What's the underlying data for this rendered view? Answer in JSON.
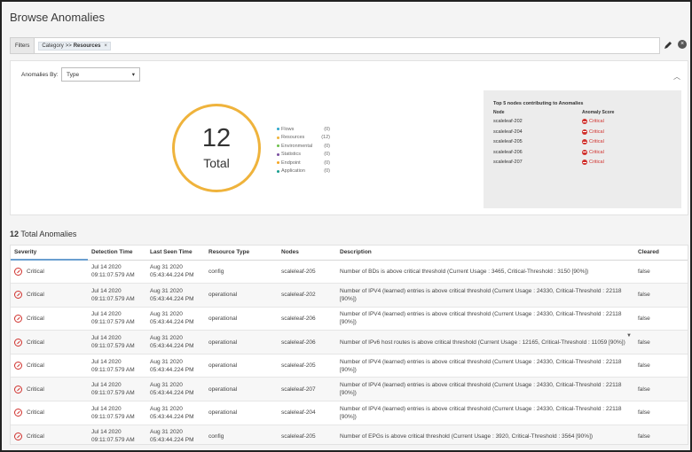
{
  "page": {
    "title": "Browse Anomalies"
  },
  "filters": {
    "label": "Filters",
    "chip_key": "Category",
    "chip_op": ">>",
    "chip_value": "Resources",
    "chip_remove": "×"
  },
  "summary": {
    "anomalies_by_label": "Anomalies By:",
    "anomalies_by_value": "Type",
    "total_count": "12",
    "total_label": "Total",
    "legend": [
      {
        "name": "Flows",
        "count": "(0)",
        "color": "#2ba6cb"
      },
      {
        "name": "Resources",
        "count": "(12)",
        "color": "#efb33c"
      },
      {
        "name": "Environmental",
        "count": "(0)",
        "color": "#6cc04a"
      },
      {
        "name": "Statistics",
        "count": "(0)",
        "color": "#7b4fa0"
      },
      {
        "name": "Endpoint",
        "count": "(0)",
        "color": "#f5a623"
      },
      {
        "name": "Application",
        "count": "(0)",
        "color": "#1a9e8f"
      }
    ],
    "ring_color": "#efb33c"
  },
  "top_nodes": {
    "title": "Top 5 nodes contributing to Anomalies",
    "col_node": "Node",
    "col_score": "Anomaly Score",
    "rows": [
      {
        "node": "scaleleaf-202",
        "score": "Critical"
      },
      {
        "node": "scaleleaf-204",
        "score": "Critical"
      },
      {
        "node": "scaleleaf-205",
        "score": "Critical"
      },
      {
        "node": "scaleleaf-206",
        "score": "Critical"
      },
      {
        "node": "scaleleaf-207",
        "score": "Critical"
      }
    ]
  },
  "table": {
    "total_count": "12",
    "total_label": "Total Anomalies",
    "columns": [
      "Severity",
      "Detection Time",
      "Last Seen Time",
      "Resource Type",
      "Nodes",
      "Description",
      "Cleared"
    ],
    "rows": [
      {
        "severity": "Critical",
        "detection_1": "Jul 14 2020",
        "detection_2": "09:11:07.579 AM",
        "last_1": "Aug 31 2020",
        "last_2": "05:43:44.224 PM",
        "resource": "config",
        "node": "scaleleaf-205",
        "description": "Number of BDs is above critical threshold (Current Usage : 3465, Critical-Threshold : 3150 [90%])",
        "cleared": "false"
      },
      {
        "severity": "Critical",
        "detection_1": "Jul 14 2020",
        "detection_2": "09:11:07.579 AM",
        "last_1": "Aug 31 2020",
        "last_2": "05:43:44.224 PM",
        "resource": "operational",
        "node": "scaleleaf-202",
        "description": "Number of IPV4 (learned) entries is above critical threshold (Current Usage : 24330, Critical-Threshold : 22118 [90%])",
        "cleared": "false"
      },
      {
        "severity": "Critical",
        "detection_1": "Jul 14 2020",
        "detection_2": "09:11:07.579 AM",
        "last_1": "Aug 31 2020",
        "last_2": "05:43:44.224 PM",
        "resource": "operational",
        "node": "scaleleaf-206",
        "description": "Number of IPV4 (learned) entries is above critical threshold (Current Usage : 24330, Critical-Threshold : 22118 [90%])",
        "cleared": "false"
      },
      {
        "severity": "Critical",
        "detection_1": "Jul 14 2020",
        "detection_2": "09:11:07.579 AM",
        "last_1": "Aug 31 2020",
        "last_2": "05:43:44.224 PM",
        "resource": "operational",
        "node": "scaleleaf-206",
        "description": "Number of IPv6 host routes is above critical threshold (Current Usage : 12165, Critical-Threshold : 11059 [90%])",
        "cleared": "false"
      },
      {
        "severity": "Critical",
        "detection_1": "Jul 14 2020",
        "detection_2": "09:11:07.579 AM",
        "last_1": "Aug 31 2020",
        "last_2": "05:43:44.224 PM",
        "resource": "operational",
        "node": "scaleleaf-205",
        "description": "Number of IPV4 (learned) entries is above critical threshold (Current Usage : 24330, Critical-Threshold : 22118 [90%])",
        "cleared": "false"
      },
      {
        "severity": "Critical",
        "detection_1": "Jul 14 2020",
        "detection_2": "09:11:07.579 AM",
        "last_1": "Aug 31 2020",
        "last_2": "05:43:44.224 PM",
        "resource": "operational",
        "node": "scaleleaf-207",
        "description": "Number of IPV4 (learned) entries is above critical threshold (Current Usage : 24330, Critical-Threshold : 22118 [90%])",
        "cleared": "false"
      },
      {
        "severity": "Critical",
        "detection_1": "Jul 14 2020",
        "detection_2": "09:11:07.579 AM",
        "last_1": "Aug 31 2020",
        "last_2": "05:43:44.224 PM",
        "resource": "operational",
        "node": "scaleleaf-204",
        "description": "Number of IPV4 (learned) entries is above critical threshold (Current Usage : 24330, Critical-Threshold : 22118 [90%])",
        "cleared": "false"
      },
      {
        "severity": "Critical",
        "detection_1": "Jul 14 2020",
        "detection_2": "09:11:07.579 AM",
        "last_1": "Aug 31 2020",
        "last_2": "05:43:44.224 PM",
        "resource": "config",
        "node": "scaleleaf-205",
        "description": "Number of EPGs is above critical threshold (Current Usage : 3920, Critical-Threshold : 3564 [90%])",
        "cleared": "false"
      }
    ]
  },
  "colors": {
    "critical": "#d0312d",
    "accent_underline": "#6a9fd0"
  },
  "icons": {
    "edit": "pencil-icon",
    "close": "close-circle-icon",
    "collapse": "chevron-up-icon",
    "dropdown": "chevron-down-icon",
    "severity": "critical-icon",
    "funnel": "filter-icon"
  }
}
